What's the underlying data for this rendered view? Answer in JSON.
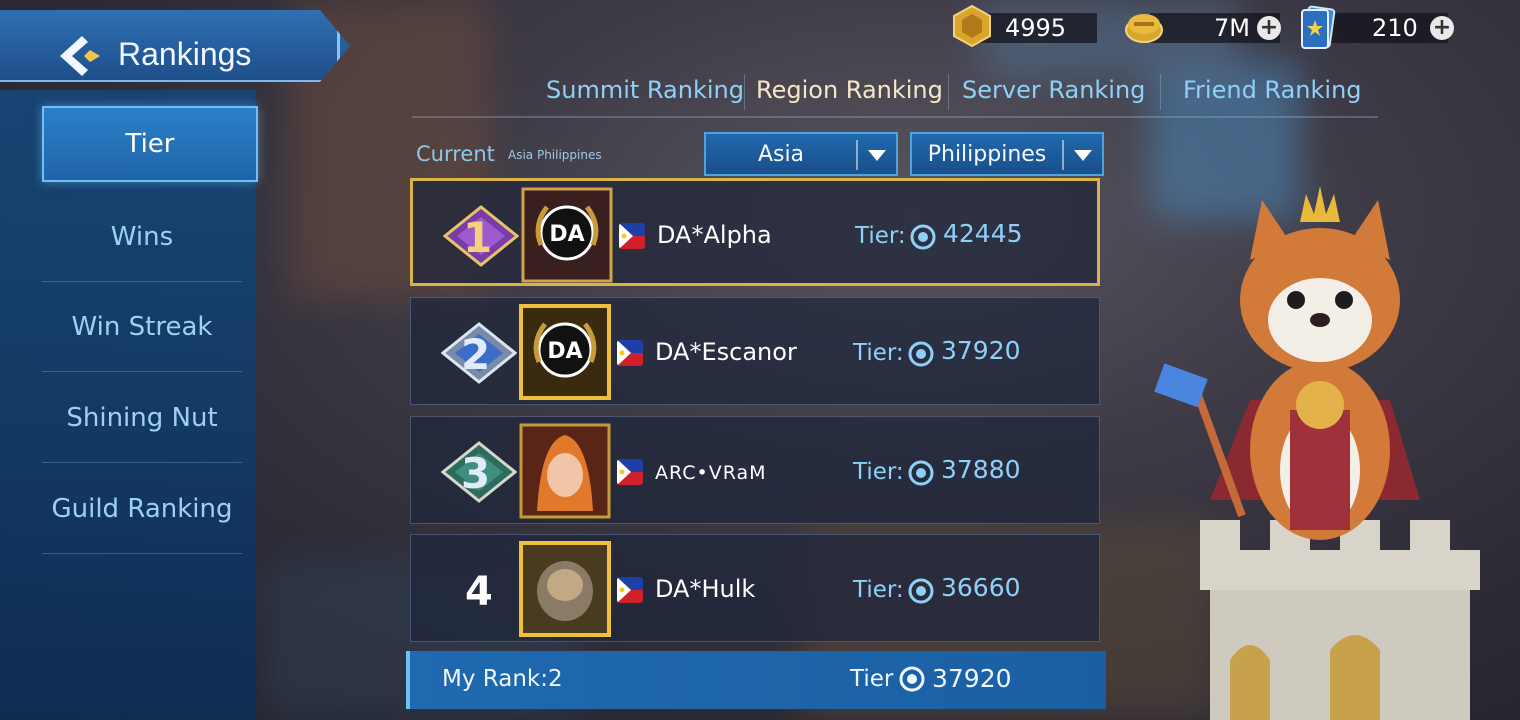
{
  "header": {
    "title": "Rankings"
  },
  "currency": [
    {
      "icon": "gold-coin-icon",
      "value": "4995",
      "has_plus": false
    },
    {
      "icon": "battle-points-icon",
      "value": "7M",
      "has_plus": true
    },
    {
      "icon": "ticket-icon",
      "value": "210",
      "has_plus": true
    }
  ],
  "sidebar": {
    "items": [
      {
        "label": "Tier",
        "active": true
      },
      {
        "label": "Wins",
        "active": false
      },
      {
        "label": "Win Streak",
        "active": false
      },
      {
        "label": "Shining Nut",
        "active": false
      },
      {
        "label": "Guild Ranking",
        "active": false
      }
    ]
  },
  "tabs": [
    {
      "label": "Summit Ranking",
      "active": false
    },
    {
      "label": "Region Ranking",
      "active": true
    },
    {
      "label": "Server Ranking",
      "active": false
    },
    {
      "label": "Friend Ranking",
      "active": false
    }
  ],
  "filter": {
    "current_label": "Current",
    "current_value": "Asia Philippines",
    "region": "Asia",
    "country": "Philippines"
  },
  "rankings": [
    {
      "rank": "1",
      "name": "DA*Alpha",
      "tier_label": "Tier:",
      "score": "42445",
      "flag": "philippines-flag-icon"
    },
    {
      "rank": "2",
      "name": "DA*Escanor",
      "tier_label": "Tier:",
      "score": "37920",
      "flag": "philippines-flag-icon"
    },
    {
      "rank": "3",
      "name": "ARC•VRaM",
      "tier_label": "Tier:",
      "score": "37880",
      "flag": "philippines-flag-icon"
    },
    {
      "rank": "4",
      "name": "DA*Hulk",
      "tier_label": "Tier:",
      "score": "36660",
      "flag": "philippines-flag-icon"
    }
  ],
  "my_rank": {
    "label": "My Rank:2",
    "tier_label": "Tier",
    "score": "37920"
  },
  "colors": {
    "accent_blue": "#1f69b0",
    "tab_text": "#8fd0f8",
    "active_tab_text": "#f6e6c8",
    "gold_border": "#d8b34a"
  }
}
